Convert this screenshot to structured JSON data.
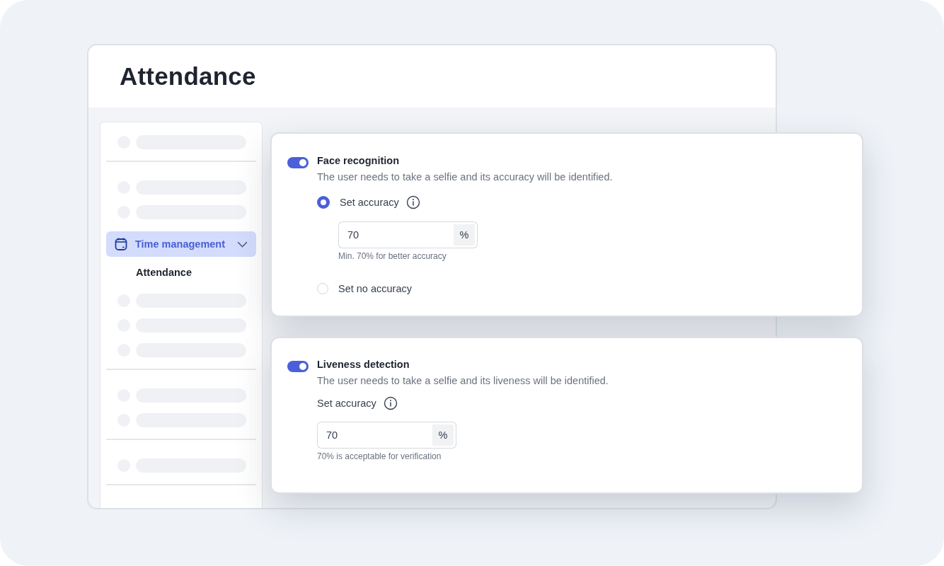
{
  "page": {
    "title": "Attendance"
  },
  "sidebar": {
    "items": [
      {
        "label": "Time management",
        "selected": true,
        "expanded": true,
        "children": [
          {
            "label": "Attendance",
            "selected": false
          }
        ]
      }
    ]
  },
  "cards": [
    {
      "kind": "options",
      "title": "Face recognition",
      "on": true,
      "description": "The user needs to take a selfie and its accuracy will be identified.",
      "options": [
        {
          "label": "Set accuracy",
          "selected": true,
          "info": true,
          "field": {
            "value": "70",
            "unit": "%",
            "hint": "Min. 70% for better accuracy"
          }
        },
        {
          "label": "Set no accuracy",
          "selected": false,
          "info": false
        }
      ]
    },
    {
      "kind": "field",
      "title": "Liveness detection",
      "on": true,
      "description": "The user needs to take a selfie and its liveness will be identified.",
      "label": "Set accuracy",
      "info": true,
      "field": {
        "value": "70",
        "unit": "%",
        "hint": "70% is acceptable for verification"
      }
    }
  ]
}
